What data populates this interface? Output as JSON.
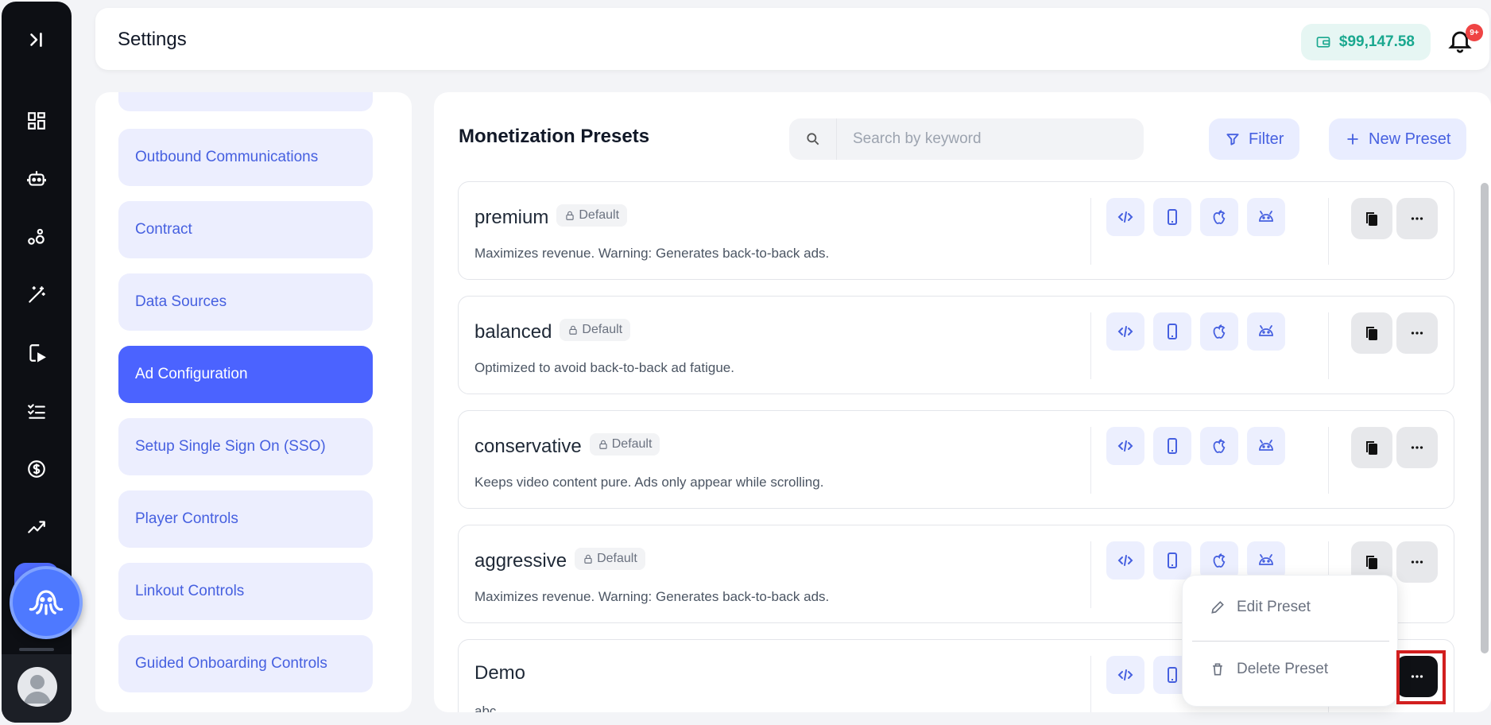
{
  "header": {
    "title": "Settings",
    "balance": "$99,147.58",
    "notification_count": "9+"
  },
  "rail": {
    "icons": [
      "collapse-icon",
      "dashboard-icon",
      "bot-icon",
      "nodes-icon",
      "magic-wand-icon",
      "mobile-play-icon",
      "checklist-icon",
      "dollar-icon",
      "trending-icon"
    ]
  },
  "settings_nav": {
    "items": [
      {
        "label": "Outbound Communications"
      },
      {
        "label": "Contract"
      },
      {
        "label": "Data Sources"
      },
      {
        "label": "Ad Configuration",
        "active": true
      },
      {
        "label": "Setup Single Sign On (SSO)"
      },
      {
        "label": "Player Controls"
      },
      {
        "label": "Linkout Controls"
      },
      {
        "label": "Guided Onboarding Controls"
      }
    ]
  },
  "main": {
    "title": "Monetization Presets",
    "search_placeholder": "Search by keyword",
    "filter_label": "Filter",
    "new_preset_label": "New Preset",
    "presets": [
      {
        "name": "premium",
        "badge": "Default",
        "description": "Maximizes revenue. Warning: Generates back-to-back ads."
      },
      {
        "name": "balanced",
        "badge": "Default",
        "description": "Optimized to avoid back-to-back ad fatigue."
      },
      {
        "name": "conservative",
        "badge": "Default",
        "description": "Keeps video content pure. Ads only appear while scrolling."
      },
      {
        "name": "aggressive",
        "badge": "Default",
        "description": "Maximizes revenue. Warning: Generates back-to-back ads."
      },
      {
        "name": "Demo",
        "badge": "",
        "description": "abc"
      }
    ]
  },
  "context_menu": {
    "edit_label": "Edit Preset",
    "delete_label": "Delete Preset"
  },
  "colors": {
    "accent": "#4b63ff",
    "accent_text": "#4660e0",
    "balance_text": "#1aa88f",
    "rail_bg": "#0d0f14",
    "highlight": "#d21f1f"
  }
}
